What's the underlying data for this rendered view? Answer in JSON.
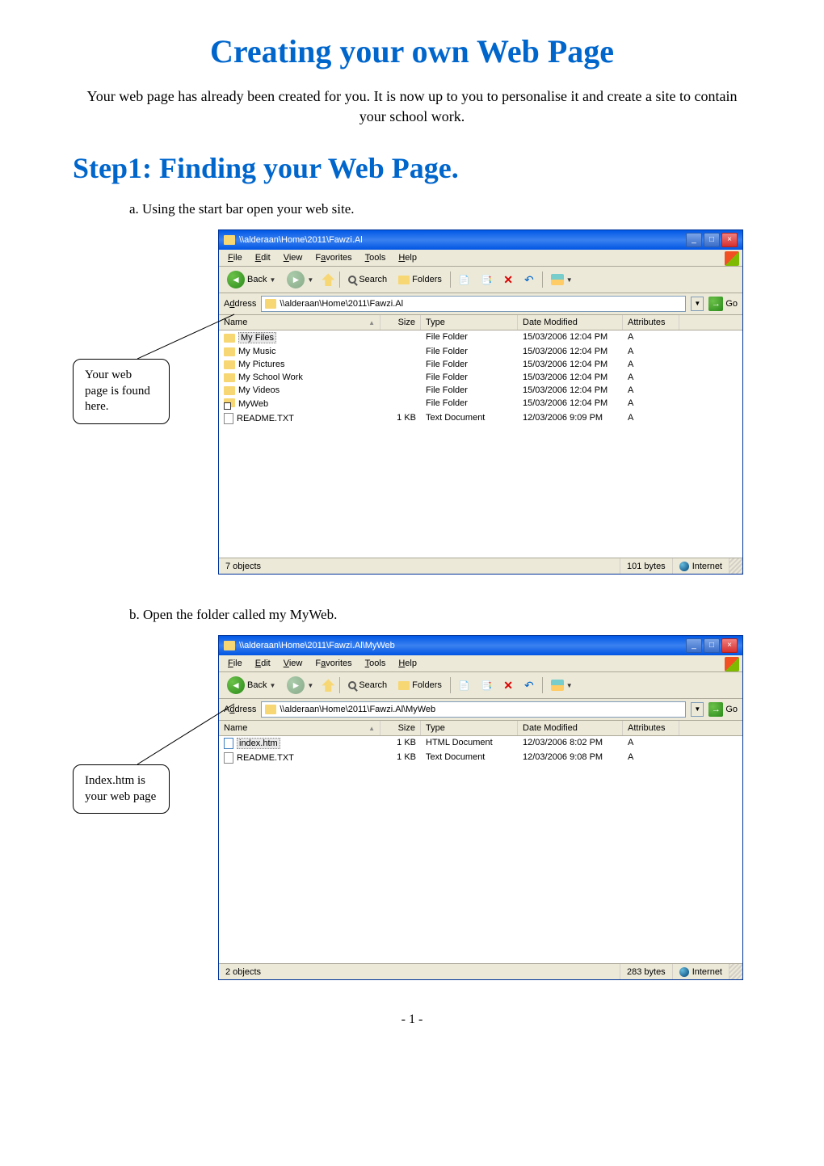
{
  "title": "Creating your own Web Page",
  "intro": "Your web page has already been created for you. It is now up to you to personalise it and create a site to contain your school work.",
  "step1_title": "Step1: Finding your Web Page.",
  "step_a": "a.  Using the start bar open your web site.",
  "step_b": "b.  Open the folder called my MyWeb.",
  "callout1": "Your web page is found here.",
  "callout2": "Index.htm is your web page",
  "page_num": "- 1 -",
  "explorer1": {
    "title": "\\\\alderaan\\Home\\2011\\Fawzi.Al",
    "address": "\\\\alderaan\\Home\\2011\\Fawzi.Al",
    "menu": [
      "File",
      "Edit",
      "View",
      "Favorites",
      "Tools",
      "Help"
    ],
    "toolbar": {
      "back": "Back",
      "search": "Search",
      "folders": "Folders"
    },
    "address_label": "Address",
    "go": "Go",
    "headers": {
      "name": "Name",
      "size": "Size",
      "type": "Type",
      "date": "Date Modified",
      "attr": "Attributes"
    },
    "rows": [
      {
        "icon": "folder",
        "name": "My Files",
        "selected": true,
        "size": "",
        "type": "File Folder",
        "date": "15/03/2006 12:04 PM",
        "attr": "A"
      },
      {
        "icon": "folder",
        "name": "My Music",
        "size": "",
        "type": "File Folder",
        "date": "15/03/2006 12:04 PM",
        "attr": "A"
      },
      {
        "icon": "folder",
        "name": "My Pictures",
        "size": "",
        "type": "File Folder",
        "date": "15/03/2006 12:04 PM",
        "attr": "A"
      },
      {
        "icon": "folder",
        "name": "My School Work",
        "size": "",
        "type": "File Folder",
        "date": "15/03/2006 12:04 PM",
        "attr": "A"
      },
      {
        "icon": "folder",
        "name": "My Videos",
        "size": "",
        "type": "File Folder",
        "date": "15/03/2006 12:04 PM",
        "attr": "A"
      },
      {
        "icon": "shortcut",
        "name": "MyWeb",
        "size": "",
        "type": "File Folder",
        "date": "15/03/2006 12:04 PM",
        "attr": "A"
      },
      {
        "icon": "txt",
        "name": "README.TXT",
        "size": "1 KB",
        "type": "Text Document",
        "date": "12/03/2006 9:09 PM",
        "attr": "A"
      }
    ],
    "status": {
      "objects": "7 objects",
      "bytes": "101 bytes",
      "zone": "Internet"
    }
  },
  "explorer2": {
    "title": "\\\\alderaan\\Home\\2011\\Fawzi.Al\\MyWeb",
    "address": "\\\\alderaan\\Home\\2011\\Fawzi.Al\\MyWeb",
    "menu": [
      "File",
      "Edit",
      "View",
      "Favorites",
      "Tools",
      "Help"
    ],
    "toolbar": {
      "back": "Back",
      "search": "Search",
      "folders": "Folders"
    },
    "address_label": "Address",
    "go": "Go",
    "headers": {
      "name": "Name",
      "size": "Size",
      "type": "Type",
      "date": "Date Modified",
      "attr": "Attributes"
    },
    "rows": [
      {
        "icon": "htm",
        "name": "index.htm",
        "selected": true,
        "size": "1 KB",
        "type": "HTML Document",
        "date": "12/03/2006 8:02 PM",
        "attr": "A"
      },
      {
        "icon": "txt",
        "name": "README.TXT",
        "size": "1 KB",
        "type": "Text Document",
        "date": "12/03/2006 9:08 PM",
        "attr": "A"
      }
    ],
    "status": {
      "objects": "2 objects",
      "bytes": "283 bytes",
      "zone": "Internet"
    }
  }
}
